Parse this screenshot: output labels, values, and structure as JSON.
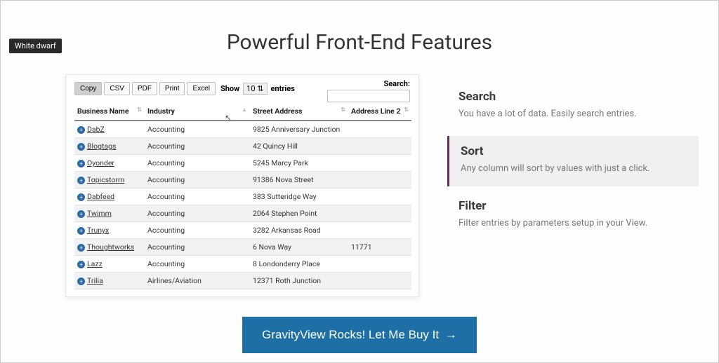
{
  "badge": "White dwarf",
  "pageTitle": "Powerful Front-End Features",
  "toolbar": {
    "copy": "Copy",
    "csv": "CSV",
    "pdf": "PDF",
    "print": "Print",
    "excel": "Excel",
    "showPrefix": "Show",
    "showValue": "10",
    "showSuffix": "entries"
  },
  "search": {
    "label": "Search:",
    "value": ""
  },
  "columns": [
    "Business Name",
    "Industry",
    "Street Address",
    "Address Line 2"
  ],
  "rows": [
    {
      "name": "DabZ",
      "industry": "Accounting",
      "street": "9825 Anniversary Junction",
      "line2": ""
    },
    {
      "name": "Blogtags",
      "industry": "Accounting",
      "street": "42 Quincy Hill",
      "line2": ""
    },
    {
      "name": "Oyonder",
      "industry": "Accounting",
      "street": "5245 Marcy Park",
      "line2": ""
    },
    {
      "name": "Topicstorm",
      "industry": "Accounting",
      "street": "91386 Nova Street",
      "line2": ""
    },
    {
      "name": "Dabfeed",
      "industry": "Accounting",
      "street": "383 Sutteridge Way",
      "line2": ""
    },
    {
      "name": "Twimm",
      "industry": "Accounting",
      "street": "2064 Stephen Point",
      "line2": ""
    },
    {
      "name": "Trunyx",
      "industry": "Accounting",
      "street": "3282 Arkansas Road",
      "line2": ""
    },
    {
      "name": "Thoughtworks",
      "industry": "Accounting",
      "street": "6 Nova Way",
      "line2": "11771"
    },
    {
      "name": "Lazz",
      "industry": "Accounting",
      "street": "8 Londonderry Place",
      "line2": ""
    },
    {
      "name": "Trilia",
      "industry": "Airlines/Aviation",
      "street": "12371 Roth Junction",
      "line2": ""
    }
  ],
  "features": [
    {
      "title": "Search",
      "desc": "You have a lot of data. Easily search entries."
    },
    {
      "title": "Sort",
      "desc": "Any column will sort by values with just a click."
    },
    {
      "title": "Filter",
      "desc": "Filter entries by parameters setup in your View."
    }
  ],
  "cta": {
    "label": "GravityView Rocks! Let Me Buy It",
    "arrow": "→"
  }
}
